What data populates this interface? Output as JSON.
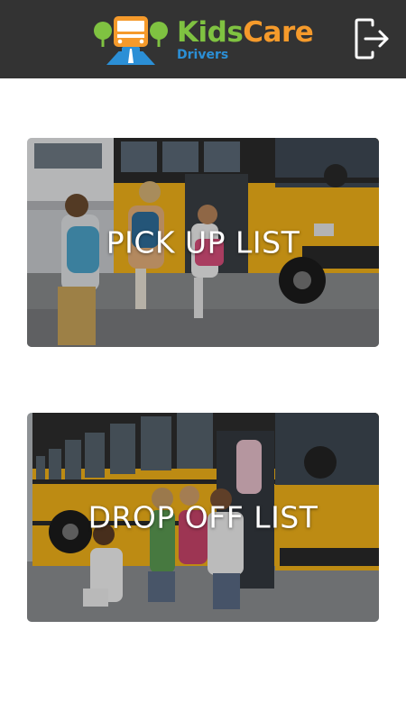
{
  "app": {
    "brand_part1": "Kids",
    "brand_part2": "Care",
    "subtitle": "Drivers"
  },
  "header": {
    "logout_icon": "logout-icon"
  },
  "cards": [
    {
      "label": "PICK UP LIST",
      "image": "children-running-to-school-bus-photo"
    },
    {
      "label": "DROP OFF LIST",
      "image": "children-exiting-school-bus-photo"
    }
  ],
  "colors": {
    "header_bg": "#333333",
    "brand_green": "#7fc241",
    "brand_orange": "#f59a2b",
    "brand_blue": "#2b8fd6",
    "bus_yellow": "#f2b319"
  }
}
